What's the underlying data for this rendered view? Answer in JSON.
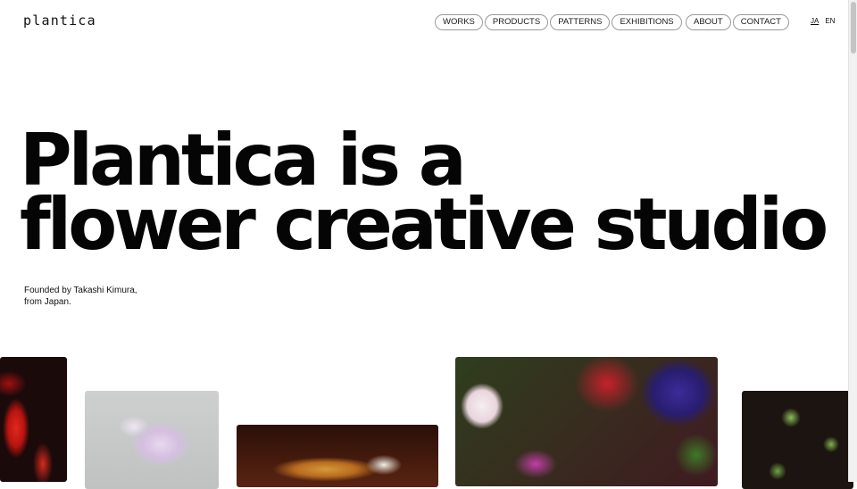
{
  "header": {
    "logo": "plantica",
    "nav_primary": [
      "WORKS",
      "PRODUCTS",
      "PATTERNS",
      "EXHIBITIONS"
    ],
    "nav_secondary": [
      "ABOUT",
      "CONTACT"
    ],
    "languages": [
      "JA",
      "EN"
    ],
    "active_language": "JA"
  },
  "hero": {
    "line1": "Plantica is a",
    "line2": "flower creative studio"
  },
  "subtitle": {
    "line1": "Founded by Takashi Kimura,",
    "line2": "from Japan."
  },
  "gallery": [
    {
      "name": "red-flower-photo"
    },
    {
      "name": "white-lavender-petal-photo"
    },
    {
      "name": "motion-blur-flower-photo"
    },
    {
      "name": "colorful-bouquet-photo"
    },
    {
      "name": "green-buds-photo"
    }
  ]
}
